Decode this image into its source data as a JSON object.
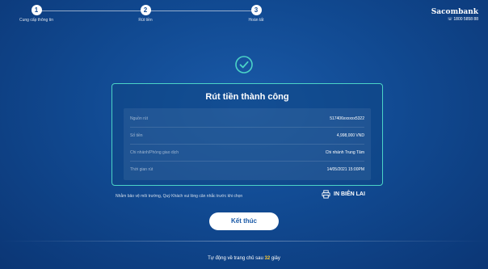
{
  "stepper": {
    "steps": [
      {
        "number": "1",
        "label": "Cung cấp thông tin"
      },
      {
        "number": "2",
        "label": "Rút tiền"
      },
      {
        "number": "3",
        "label": "Hoàn tất"
      }
    ]
  },
  "brand": {
    "name": "Sacombank",
    "hotline": "1800 5858 88"
  },
  "success_icon": "check-circle-icon",
  "card": {
    "title": "Rút tiền thành công",
    "rows": [
      {
        "label": "Nguồn rút",
        "value": "517406xxxxxx5322"
      },
      {
        "label": "Số tiền",
        "value": "4,998,000 VND"
      },
      {
        "label": "Chi nhánh/Phòng giao dịch",
        "value": "Chi nhánh Trung Tâm"
      },
      {
        "label": "Thời gian rút",
        "value": "14/05/2021 15:00PM"
      }
    ]
  },
  "note": "Nhằm bảo vệ môi trường, Quý Khách vui lòng cân nhắc trước khi chọn",
  "print_button": {
    "label": "IN BIÊN LAI",
    "icon": "printer-icon"
  },
  "finish_button": {
    "label": "Kết thúc"
  },
  "countdown": {
    "prefix": "Tự động về trang chủ sau",
    "seconds": "32",
    "suffix": "giây"
  },
  "colors": {
    "accent": "#4bd3c7",
    "highlight": "#ffcc33",
    "background": "#114a92"
  }
}
